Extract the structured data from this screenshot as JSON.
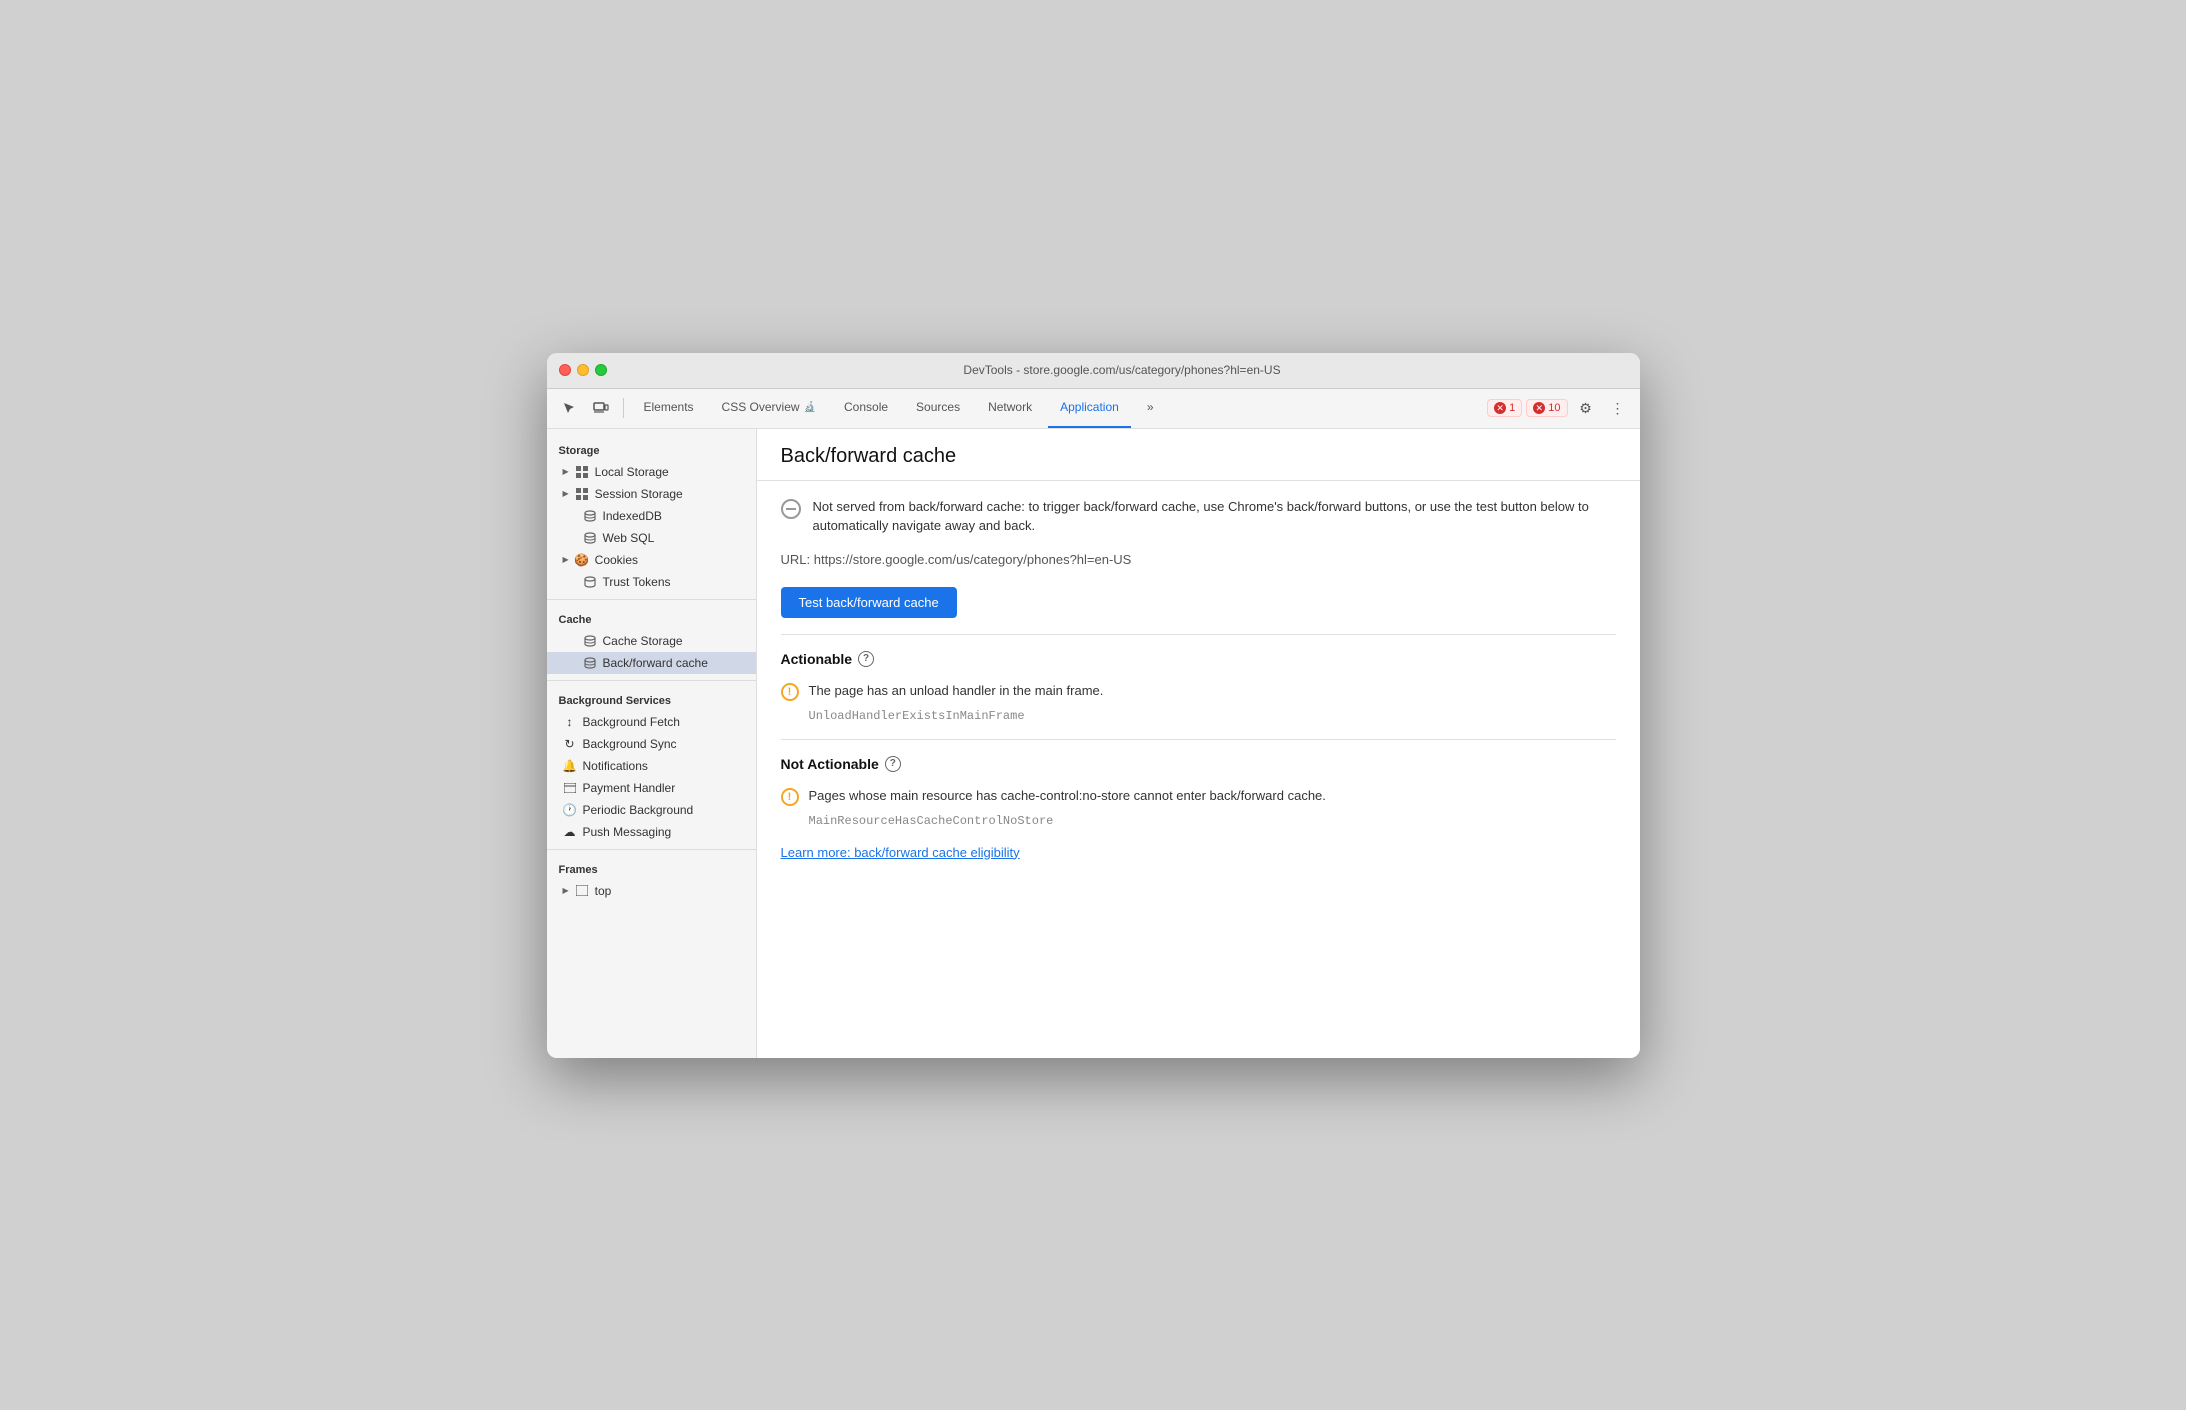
{
  "window": {
    "title": "DevTools - store.google.com/us/category/phones?hl=en-US"
  },
  "toolbar": {
    "tabs": [
      {
        "label": "Elements",
        "active": false
      },
      {
        "label": "CSS Overview",
        "active": false
      },
      {
        "label": "Console",
        "active": false
      },
      {
        "label": "Sources",
        "active": false
      },
      {
        "label": "Network",
        "active": false
      },
      {
        "label": "Application",
        "active": true
      },
      {
        "label": "»",
        "active": false
      }
    ],
    "error_count": "1",
    "warning_count": "10"
  },
  "sidebar": {
    "storage_header": "Storage",
    "items": [
      {
        "label": "Local Storage",
        "icon": "grid",
        "expandable": true,
        "indent": false
      },
      {
        "label": "Session Storage",
        "icon": "grid",
        "expandable": true,
        "indent": false
      },
      {
        "label": "IndexedDB",
        "icon": "db",
        "expandable": false,
        "indent": false
      },
      {
        "label": "Web SQL",
        "icon": "db",
        "expandable": false,
        "indent": false
      },
      {
        "label": "Cookies",
        "icon": "cookie",
        "expandable": true,
        "indent": false
      },
      {
        "label": "Trust Tokens",
        "icon": "db",
        "expandable": false,
        "indent": false
      }
    ],
    "cache_header": "Cache",
    "cache_items": [
      {
        "label": "Cache Storage",
        "icon": "db",
        "expandable": false,
        "active": false
      },
      {
        "label": "Back/forward cache",
        "icon": "db",
        "expandable": false,
        "active": true
      }
    ],
    "bg_header": "Background Services",
    "bg_items": [
      {
        "label": "Background Fetch",
        "icon": "arrows"
      },
      {
        "label": "Background Sync",
        "icon": "sync"
      },
      {
        "label": "Notifications",
        "icon": "bell"
      },
      {
        "label": "Payment Handler",
        "icon": "payment"
      },
      {
        "label": "Periodic Background",
        "icon": "clock"
      },
      {
        "label": "Push Messaging",
        "icon": "cloud"
      }
    ],
    "frames_header": "Frames",
    "frames_items": [
      {
        "label": "top",
        "icon": "frame",
        "expandable": true
      }
    ]
  },
  "main": {
    "title": "Back/forward cache",
    "info_text": "Not served from back/forward cache: to trigger back/forward cache, use Chrome's back/forward buttons, or use the test button below to automatically navigate away and back.",
    "url_label": "URL:",
    "url_value": "https://store.google.com/us/category/phones?hl=en-US",
    "test_button": "Test back/forward cache",
    "actionable_label": "Actionable",
    "actionable_issue_text": "The page has an unload handler in the main frame.",
    "actionable_issue_code": "UnloadHandlerExistsInMainFrame",
    "not_actionable_label": "Not Actionable",
    "not_actionable_issue_text": "Pages whose main resource has cache-control:no-store cannot enter back/forward cache.",
    "not_actionable_issue_code": "MainResourceHasCacheControlNoStore",
    "learn_more": "Learn more: back/forward cache eligibility"
  }
}
